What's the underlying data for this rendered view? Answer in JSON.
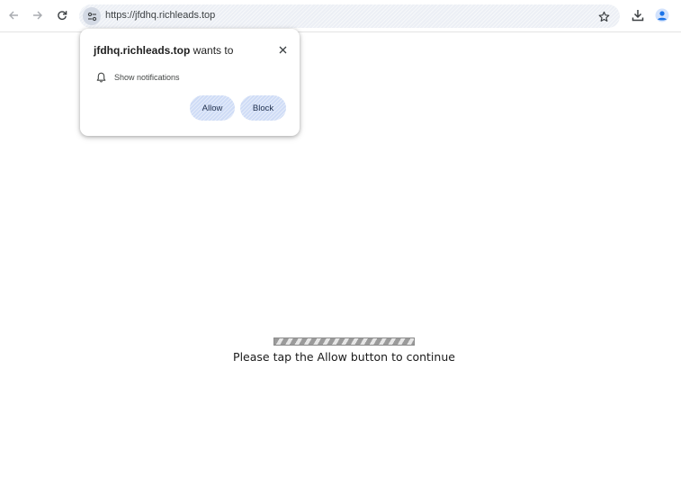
{
  "browser": {
    "url": "https://jfdhq.richleads.top",
    "icons": {
      "back": "arrow-left-icon",
      "forward": "arrow-right-icon",
      "reload": "reload-icon",
      "site_info": "tune-icon",
      "bookmark": "star-icon",
      "download": "download-icon",
      "profile": "account-icon"
    }
  },
  "permission_prompt": {
    "domain": "jfdhq.richleads.top",
    "wants_to": " wants to",
    "permission_label": "Show notifications",
    "allow_label": "Allow",
    "block_label": "Block",
    "icons": {
      "permission": "bell-icon",
      "close": "close-icon"
    }
  },
  "page": {
    "progress_fraction": 1.0,
    "message": "Please tap the Allow button to continue"
  },
  "colors": {
    "pill_button": "#cfdcf6",
    "omnibox": "#eceff5",
    "profile_accent": "#1a73e8"
  }
}
